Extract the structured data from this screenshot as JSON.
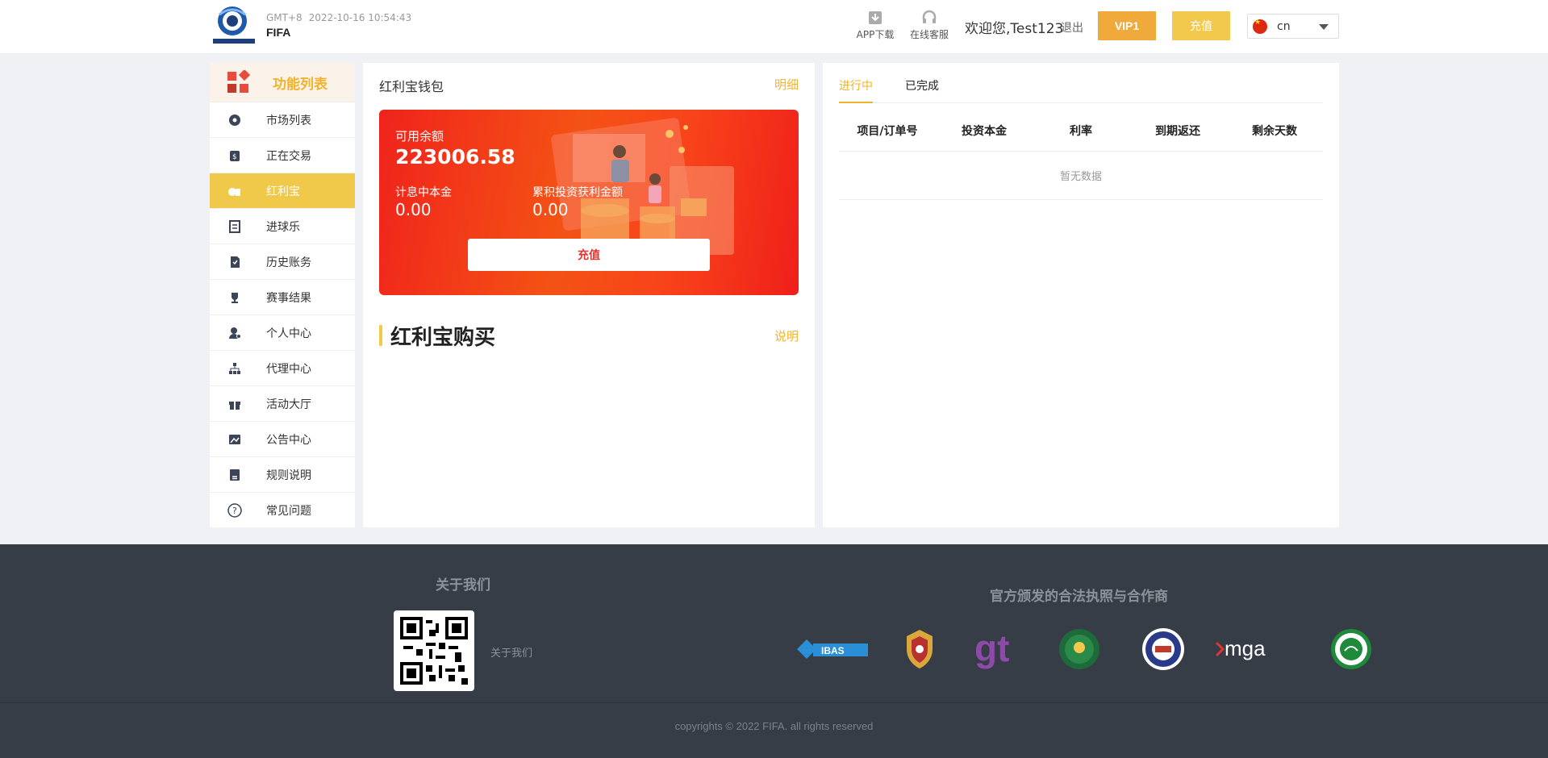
{
  "header": {
    "timezone": "GMT+8",
    "datetime": "2022-10-16 10:54:43",
    "site_name": "FIFA",
    "app_download": "APP下载",
    "online_service": "在线客服",
    "welcome": "欢迎您,Test123",
    "logout": "退出",
    "vip": "VIP1",
    "recharge": "充值",
    "language": "cn"
  },
  "sidebar": {
    "title": "功能列表",
    "items": [
      {
        "label": "市场列表",
        "icon": "soccer-ball-icon"
      },
      {
        "label": "正在交易",
        "icon": "money-bag-icon"
      },
      {
        "label": "红利宝",
        "icon": "coins-icon",
        "active": true
      },
      {
        "label": "进球乐",
        "icon": "receipt-icon"
      },
      {
        "label": "历史账务",
        "icon": "history-doc-icon"
      },
      {
        "label": "赛事结果",
        "icon": "trophy-icon"
      },
      {
        "label": "个人中心",
        "icon": "user-gear-icon"
      },
      {
        "label": "代理中心",
        "icon": "org-chart-icon"
      },
      {
        "label": "活动大厅",
        "icon": "gift-icon"
      },
      {
        "label": "公告中心",
        "icon": "image-icon"
      },
      {
        "label": "规则说明",
        "icon": "book-icon"
      },
      {
        "label": "常见问题",
        "icon": "question-icon"
      }
    ]
  },
  "wallet": {
    "title": "红利宝钱包",
    "detail": "明细",
    "available_label": "可用余额",
    "available_value": "223006.58",
    "principal_label": "计息中本金",
    "principal_value": "0.00",
    "cumulative_label": "累积投资获利金额",
    "cumulative_value": "0.00",
    "recharge_button": "充值"
  },
  "purchase": {
    "title": "红利宝购买",
    "note": "说明"
  },
  "orders": {
    "tabs": [
      "进行中",
      "已完成"
    ],
    "columns": [
      "项目/订单号",
      "投资本金",
      "利率",
      "到期返还",
      "剩余天数"
    ],
    "empty": "暂无数据"
  },
  "footer": {
    "about_title": "关于我们",
    "about_link": "关于我们",
    "license_title": "官方颁发的合法执照与合作商",
    "partners": [
      "IBAS",
      "gt",
      "mga"
    ],
    "copyright": "copyrights © 2022 FIFA. all rights reserved"
  },
  "colors": {
    "accent": "#f2b32b",
    "vip": "#f0a93b",
    "recharge": "#f2c94c",
    "card_red": "#f0231c",
    "footer_bg": "#373d47"
  }
}
